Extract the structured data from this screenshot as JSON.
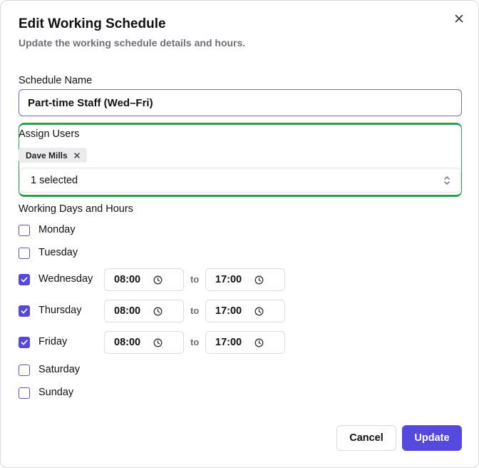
{
  "dialog": {
    "title": "Edit Working Schedule",
    "subtitle": "Update the working schedule details and hours."
  },
  "schedule_name": {
    "label": "Schedule Name",
    "value": "Part-time Staff (Wed–Fri)"
  },
  "assign_users": {
    "label": "Assign Users",
    "chips": [
      "Dave Mills"
    ],
    "select_text": "1 selected"
  },
  "working_days": {
    "label": "Working Days and Hours",
    "to_label": "to",
    "days": [
      {
        "name": "Monday",
        "checked": false
      },
      {
        "name": "Tuesday",
        "checked": false
      },
      {
        "name": "Wednesday",
        "checked": true,
        "start": "08:00",
        "end": "17:00"
      },
      {
        "name": "Thursday",
        "checked": true,
        "start": "08:00",
        "end": "17:00"
      },
      {
        "name": "Friday",
        "checked": true,
        "start": "08:00",
        "end": "17:00"
      },
      {
        "name": "Saturday",
        "checked": false
      },
      {
        "name": "Sunday",
        "checked": false
      }
    ]
  },
  "actions": {
    "cancel_label": "Cancel",
    "update_label": "Update"
  },
  "colors": {
    "accent": "#5548dd",
    "focus_border": "#6e63d6",
    "highlight_border": "#2f9e4a"
  },
  "icons": {
    "close": "close-icon",
    "chip_remove": "close-icon",
    "select_toggle": "chevron-up-down-icon",
    "time": "clock-icon",
    "check": "check-icon"
  }
}
